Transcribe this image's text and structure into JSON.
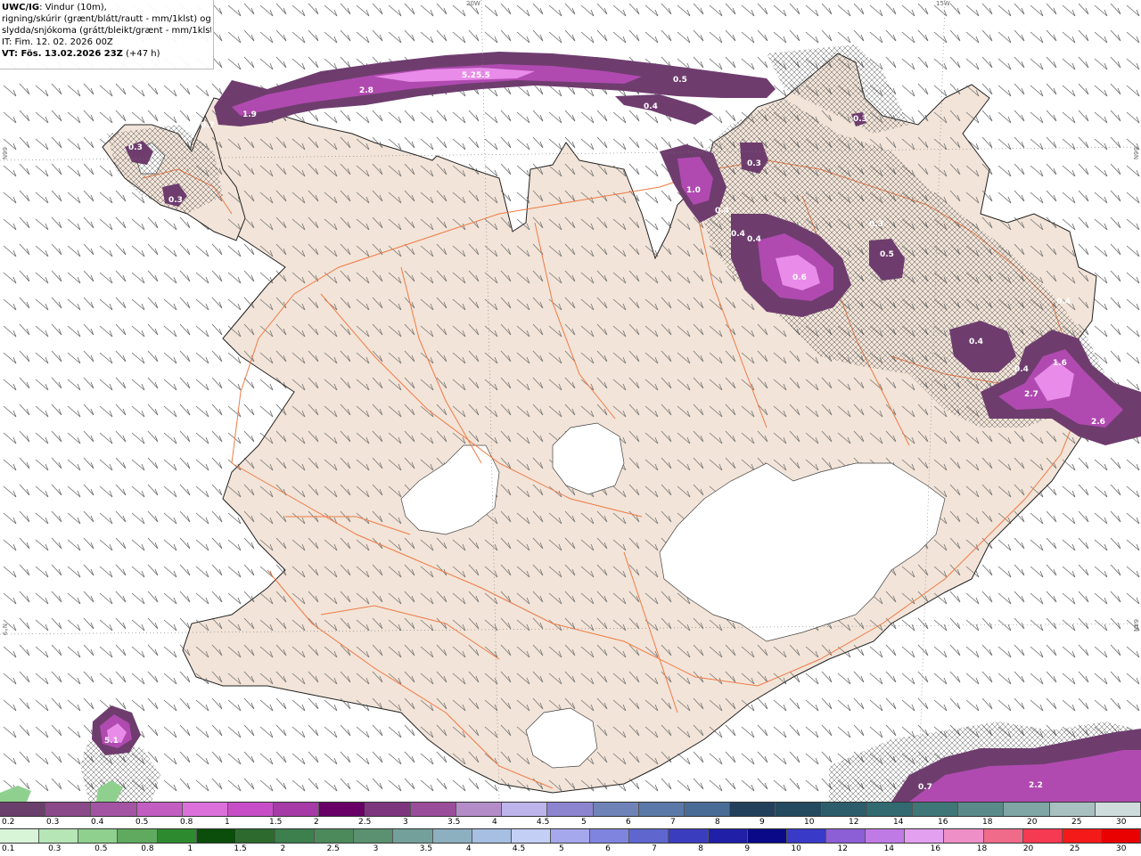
{
  "header": {
    "model": "UWC/IG",
    "line1_rest": ": Vindur (10m),",
    "line2": "rigning/skúrir (grænt/blátt/rautt - mm/1klst) og",
    "line3": "slydda/snjókoma (grátt/bleikt/grænt - mm/1klst)",
    "line4": "IT: Fim. 12. 02. 2026 00Z",
    "line5_bold": "VT: Fös. 13.02.2026 23Z",
    "line5_rest": " (+47 h)"
  },
  "coord_labels": {
    "top_left": "20W",
    "top_right": "15W",
    "left_upper": "66N",
    "right_upper": "66N",
    "left_lower": "N°9",
    "right_lower": "64N"
  },
  "precip_labels": [
    "5.25.5",
    "2.8",
    "1.9",
    "0.7",
    "0.5",
    "0.4",
    "0.3",
    "0.3",
    "0.3",
    "0.3",
    "1.0",
    "0.4",
    "0.4",
    "0.4",
    "0.6",
    "0.3",
    "0.5",
    "0.4",
    "0.4",
    "1.6",
    "2.7",
    "2.6",
    "0.4",
    "5.1",
    "0.7",
    "2.2"
  ],
  "colors": {
    "land": "#f2e4d8",
    "sea": "#ffffff",
    "roads": "#f07a45",
    "glacier": "#ffffff",
    "snow_dark": "#6e3d6e",
    "snow_mid": "#b04ab0",
    "snow_light": "#e98be9"
  },
  "legend_top": {
    "colors": [
      "#6b3f6b",
      "#8a4a8a",
      "#a354a3",
      "#c25ec2",
      "#db70db",
      "#c84ec8",
      "#a63aa6",
      "#680068",
      "#7d357d",
      "#9a4d9a",
      "#b38cc8",
      "#bcb4ea",
      "#8d84d0",
      "#6f83b9",
      "#5a79a8",
      "#486c96",
      "#22405c",
      "#234a5f",
      "#2b5d6b",
      "#316a70",
      "#3f7677",
      "#5a8a8a",
      "#7fa5a5",
      "#a8c0c0",
      "#cfdcdc"
    ],
    "ticks": [
      "0.2",
      "0.3",
      "0.4",
      "0.5",
      "0.8",
      "1",
      "1.5",
      "2",
      "2.5",
      "3",
      "3.5",
      "4",
      "4.5",
      "5",
      "6",
      "7",
      "8",
      "9",
      "10",
      "12",
      "14",
      "16",
      "18",
      "20",
      "25",
      "30"
    ]
  },
  "legend_bottom": {
    "colors": [
      "#d8f5d8",
      "#b6e6b6",
      "#8fd08f",
      "#5faa5f",
      "#2e8a2e",
      "#0b4d0b",
      "#2d6a2d",
      "#3d7f4d",
      "#4c8a5c",
      "#5b9070",
      "#73a09a",
      "#8cb0c0",
      "#a6bfe2",
      "#c3cff5",
      "#a5a8ec",
      "#7f84de",
      "#5f67cf",
      "#3b3dbf",
      "#1f1fa8",
      "#0a0a88",
      "#3a3ac8",
      "#8d5fd6",
      "#c07ae6",
      "#e39ff0",
      "#ee8fc8",
      "#f06a8a",
      "#f53a52",
      "#f51a1a",
      "#e90000"
    ],
    "ticks": [
      "0.1",
      "0.3",
      "0.5",
      "0.8",
      "1",
      "1.5",
      "2",
      "2.5",
      "3",
      "3.5",
      "4",
      "4.5",
      "5",
      "6",
      "7",
      "8",
      "9",
      "10",
      "12",
      "14",
      "16",
      "18",
      "20",
      "25",
      "30"
    ]
  }
}
